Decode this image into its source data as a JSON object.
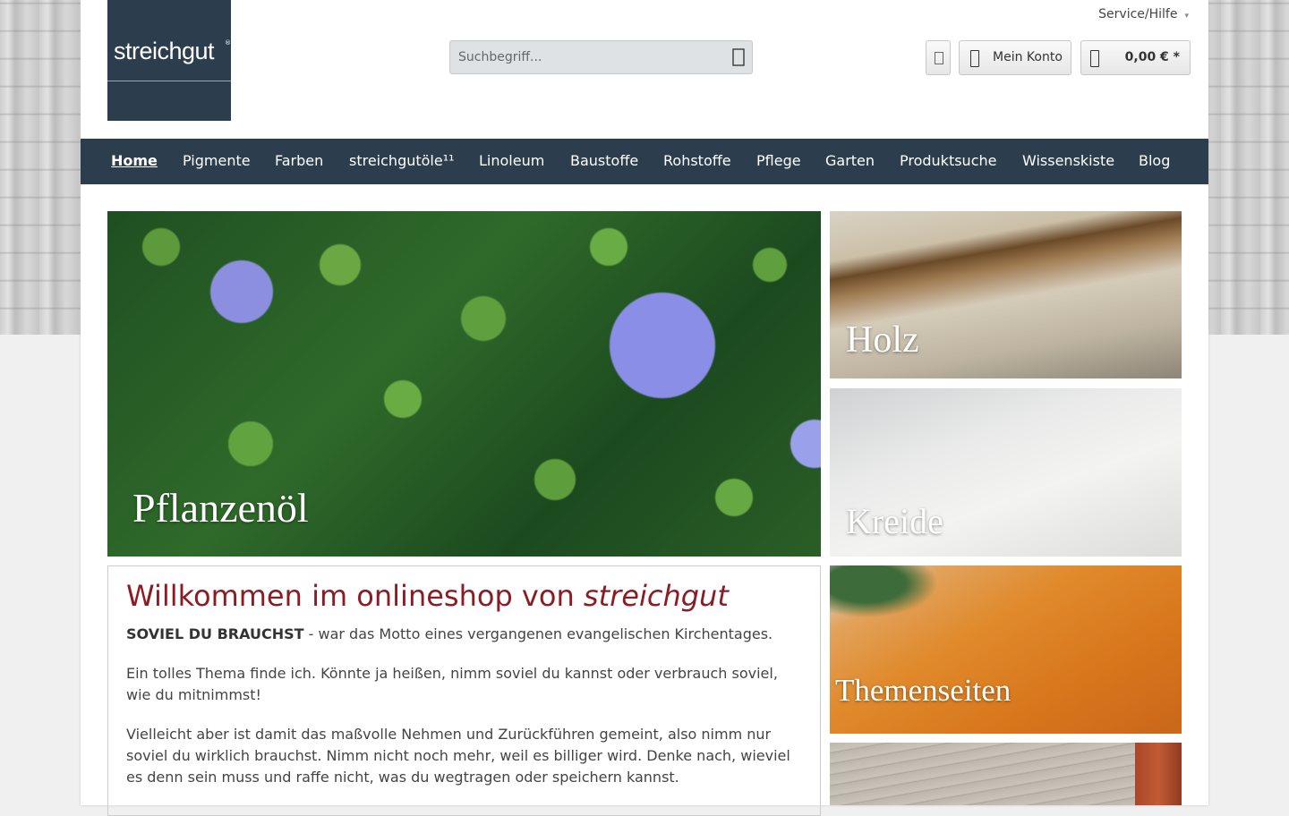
{
  "header": {
    "logo_text": "streichgut",
    "logo_mark": "®",
    "service_label": "Service/Hilfe",
    "search_placeholder": "Suchbegriff...",
    "account_label": "Mein Konto",
    "cart_total": "0,00 € *"
  },
  "nav": [
    {
      "label": "Home",
      "active": true
    },
    {
      "label": "Pigmente"
    },
    {
      "label": "Farben"
    },
    {
      "label": "streichgutöle¹¹"
    },
    {
      "label": "Linoleum"
    },
    {
      "label": "Baustoffe"
    },
    {
      "label": "Rohstoffe"
    },
    {
      "label": "Pflege"
    },
    {
      "label": "Garten"
    },
    {
      "label": "Produktsuche"
    },
    {
      "label": "Wissenskiste"
    },
    {
      "label": "Blog"
    }
  ],
  "tiles": {
    "hero": "Pflanzenöl",
    "holz": "Holz",
    "kreide": "Kreide",
    "themen": "Themenseiten"
  },
  "welcome": {
    "title_plain": "Willkommen im onlineshop von ",
    "title_em": "streichgut",
    "p1_strong": "SOVIEL DU BRAUCHST",
    "p1_rest": " - war das Motto eines vergangenen evangelischen Kirchentages.",
    "p2": "Ein tolles Thema finde ich. Könnte ja heißen, nimm soviel du kannst oder verbrauch soviel, wie du mitnimmst!",
    "p3": "Vielleicht aber ist damit das maßvolle Nehmen und Zurückführen gemeint, also nimm nur soviel du wirklich brauchst. Nimm nicht noch mehr, weil es billiger wird. Denke nach, wieviel es denn sein muss und raffe nicht, was du wegtragen oder speichern kannst."
  },
  "colors": {
    "nav_bg": "#2c3e4e",
    "title_red": "#8b1c24"
  }
}
